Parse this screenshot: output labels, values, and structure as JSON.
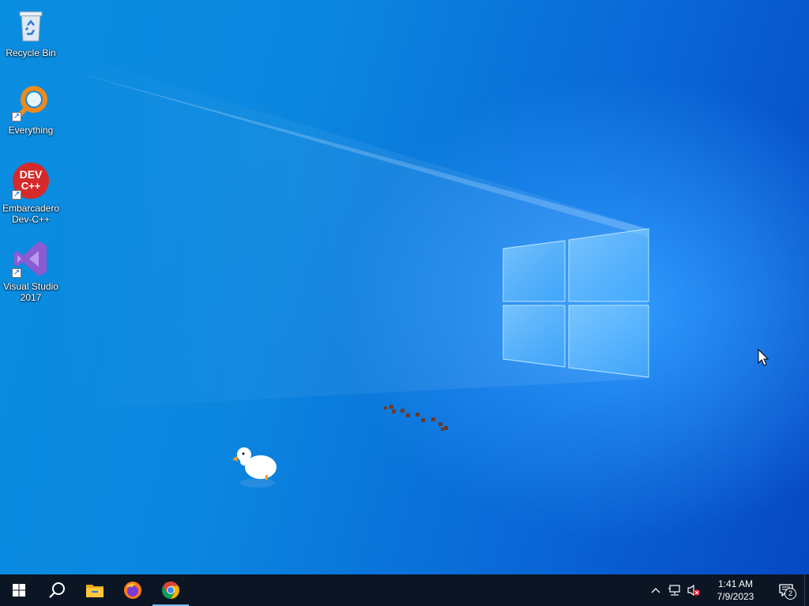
{
  "desktop": {
    "icons": [
      {
        "label": "Recycle Bin",
        "icon": "recycle-bin-icon"
      },
      {
        "label": "Everything",
        "icon": "everything-search-icon"
      },
      {
        "label": "Embarcadero Dev-C++",
        "icon": "devcpp-icon",
        "logo_text": "DEV C++"
      },
      {
        "label": "Visual Studio 2017",
        "icon": "visual-studio-icon"
      }
    ],
    "extras": [
      "desktop-goose-icon",
      "goose-footprints-icon",
      "mouse-cursor-icon"
    ]
  },
  "taskbar": {
    "buttons": [
      "start-icon",
      "search-icon",
      "file-explorer-icon",
      "firefox-icon",
      "chrome-icon"
    ],
    "active": "chrome-icon",
    "tray": {
      "icons": [
        "show-hidden-icons-icon",
        "network-icon",
        "volume-muted-icon"
      ],
      "time": "1:41 AM",
      "date": "7/9/2023",
      "notification_count": "2"
    }
  },
  "colors": {
    "taskbar": "#0b1524",
    "desktop_accent": "#0a6bd8",
    "active_indicator": "#76b9ed"
  }
}
